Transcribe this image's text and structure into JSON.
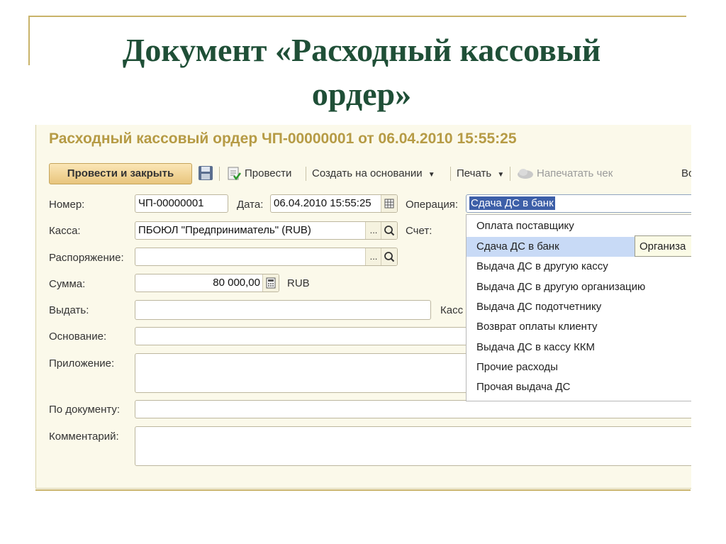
{
  "slide": {
    "title_line1": "Документ «Расходный кассовый",
    "title_line2": "ордер»"
  },
  "window": {
    "title": "Расходный кассовый ордер ЧП-00000001 от 06.04.2010 15:55:25"
  },
  "toolbar": {
    "post_close_label": "Провести и закрыть",
    "post_label": "Провести",
    "create_based_label": "Создать на основании",
    "print_label": "Печать",
    "print_receipt_label": "Напечатать чек",
    "more_label": "Во"
  },
  "form": {
    "number_label": "Номер:",
    "number_value": "ЧП-00000001",
    "date_label": "Дата:",
    "date_value": "06.04.2010 15:55:25",
    "operation_label": "Операция:",
    "operation_value": "Сдача ДС в банк",
    "cashbox_label": "Касса:",
    "cashbox_value": "ПБОЮЛ \"Предприниматель\" (RUB)",
    "account_label": "Счет:",
    "order_label": "Распоряжение:",
    "order_value": "",
    "amount_label": "Сумма:",
    "amount_value": "80 000,00",
    "currency_label": "RUB",
    "issue_label": "Выдать:",
    "issue_value": "",
    "cashier_label_partial": "Касс",
    "basis_label": "Основание:",
    "basis_value": "",
    "attachment_label": "Приложение:",
    "attachment_value": "",
    "by_document_label": "По документу:",
    "by_document_value": "",
    "comment_label": "Комментарий:",
    "comment_value": "",
    "ellipsis": "...",
    "search_glyph": "⌕"
  },
  "dropdown": {
    "items": [
      "Оплата поставщику",
      "Сдача ДС в банк",
      "Выдача ДС в другую кассу",
      "Выдача ДС в другую организацию",
      "Выдача ДС подотчетнику",
      "Возврат оплаты клиенту",
      "Выдача ДС в кассу ККМ",
      "Прочие расходы",
      "Прочая выдача ДС"
    ],
    "selected": "Сдача ДС в банк"
  },
  "tooltip": {
    "text": "Организа"
  },
  "colors": {
    "title_green": "#1f4f37",
    "window_title_gold": "#b69b45",
    "selection_blue": "#c8daf6",
    "frame_gold": "#c9b36a"
  }
}
